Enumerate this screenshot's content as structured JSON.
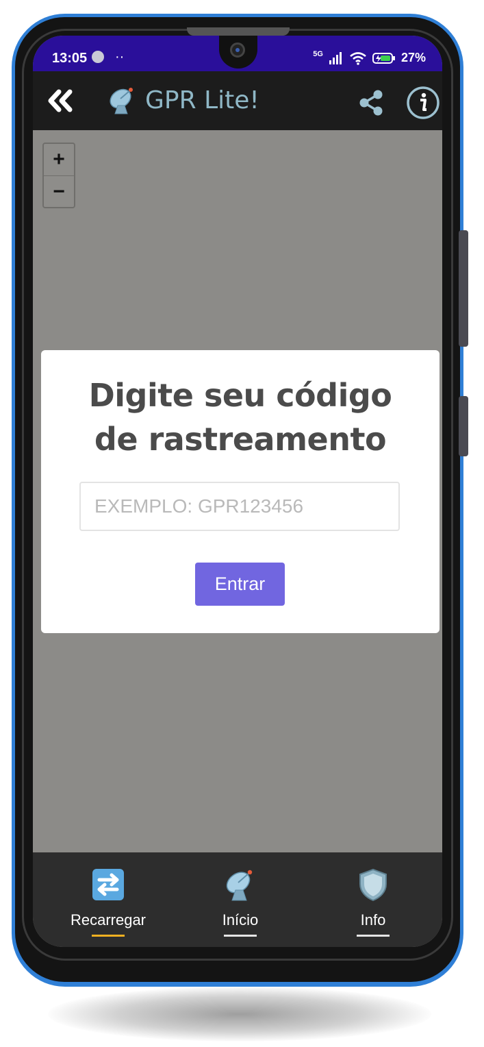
{
  "status_bar": {
    "time": "13:05",
    "dots": "··",
    "network": "5G",
    "battery": "27%"
  },
  "app_bar": {
    "title": "GPR Lite!",
    "back_icon": "double-chevron-left-icon",
    "logo_icon": "satellite-dish-icon",
    "share_icon": "share-icon",
    "info_icon": "info-circle-icon"
  },
  "map": {
    "zoom_in": "+",
    "zoom_out": "−"
  },
  "modal": {
    "title_line1": "Digite seu código",
    "title_line2": "de rastreamento",
    "input_placeholder": "EXEMPLO: GPR123456",
    "input_value": "",
    "submit_label": "Entrar"
  },
  "bottom_nav": {
    "items": [
      {
        "label": "Recarregar",
        "icon": "refresh-icon",
        "active": true
      },
      {
        "label": "Início",
        "icon": "satellite-dish-icon",
        "active": false
      },
      {
        "label": "Info",
        "icon": "shield-icon",
        "active": false
      }
    ]
  },
  "colors": {
    "status_bar": "#2a0f9a",
    "app_bar": "#1c1c1c",
    "title": "#8fb7c6",
    "map": "#8c8b88",
    "button": "#7166e0",
    "bottom_nav": "#2d2d2d",
    "active_underline": "#f2b021",
    "phone_frame": "#2f7fd6"
  }
}
